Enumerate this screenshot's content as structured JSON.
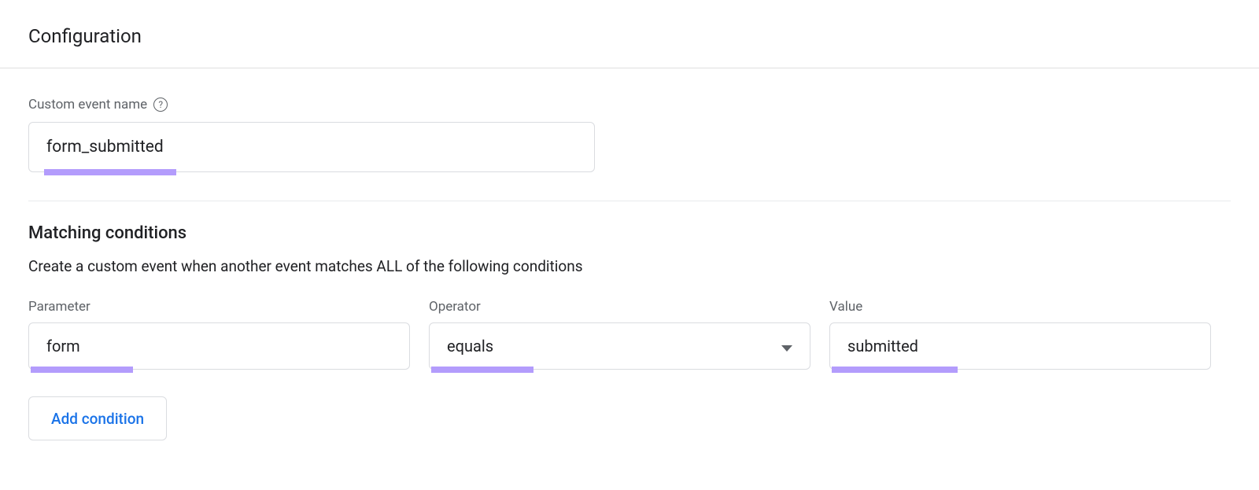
{
  "page": {
    "title": "Configuration"
  },
  "eventName": {
    "label": "Custom event name",
    "value": "form_submitted",
    "highlightWidth": "168px"
  },
  "matching": {
    "heading": "Matching conditions",
    "description": "Create a custom event when another event matches ALL of the following conditions",
    "labels": {
      "parameter": "Parameter",
      "operator": "Operator",
      "value": "Value"
    },
    "condition": {
      "parameter": "form",
      "parameterHighlightWidth": "130px",
      "operator": "equals",
      "operatorHighlightWidth": "130px",
      "value": "submitted",
      "valueHighlightWidth": "160px"
    },
    "addButton": "Add condition"
  }
}
